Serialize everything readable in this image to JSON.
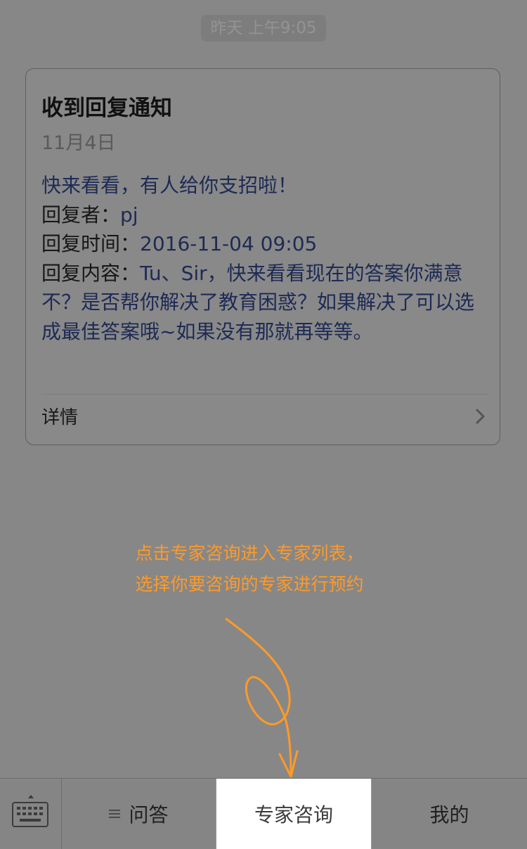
{
  "timestamp": "昨天 上午9:05",
  "card": {
    "title": "收到回复通知",
    "date": "11月4日",
    "intro": "快来看看，有人给你支招啦！",
    "replier_label": "回复者：",
    "replier_value": "pj",
    "time_label": "回复时间：",
    "time_value": "2016-11-04 09:05",
    "content_label": "回复内容：",
    "content_value": "Tu、Sir，快来看看现在的答案你满意不？是否帮你解决了教育困惑？如果解决了可以选成最佳答案哦~如果没有那就再等等。",
    "details_label": "详情",
    "chevron_icon": "chevron-right-icon"
  },
  "hint": {
    "line1": "点击专家咨询进入专家列表，",
    "line2": "选择你要咨询的专家进行预约",
    "color": "#ff9a27"
  },
  "tabbar": {
    "keyboard_icon": "keyboard-icon",
    "menu_icon": "menu-icon",
    "tabs": [
      {
        "label": "问答"
      },
      {
        "label": "专家咨询"
      },
      {
        "label": "我的"
      }
    ]
  }
}
